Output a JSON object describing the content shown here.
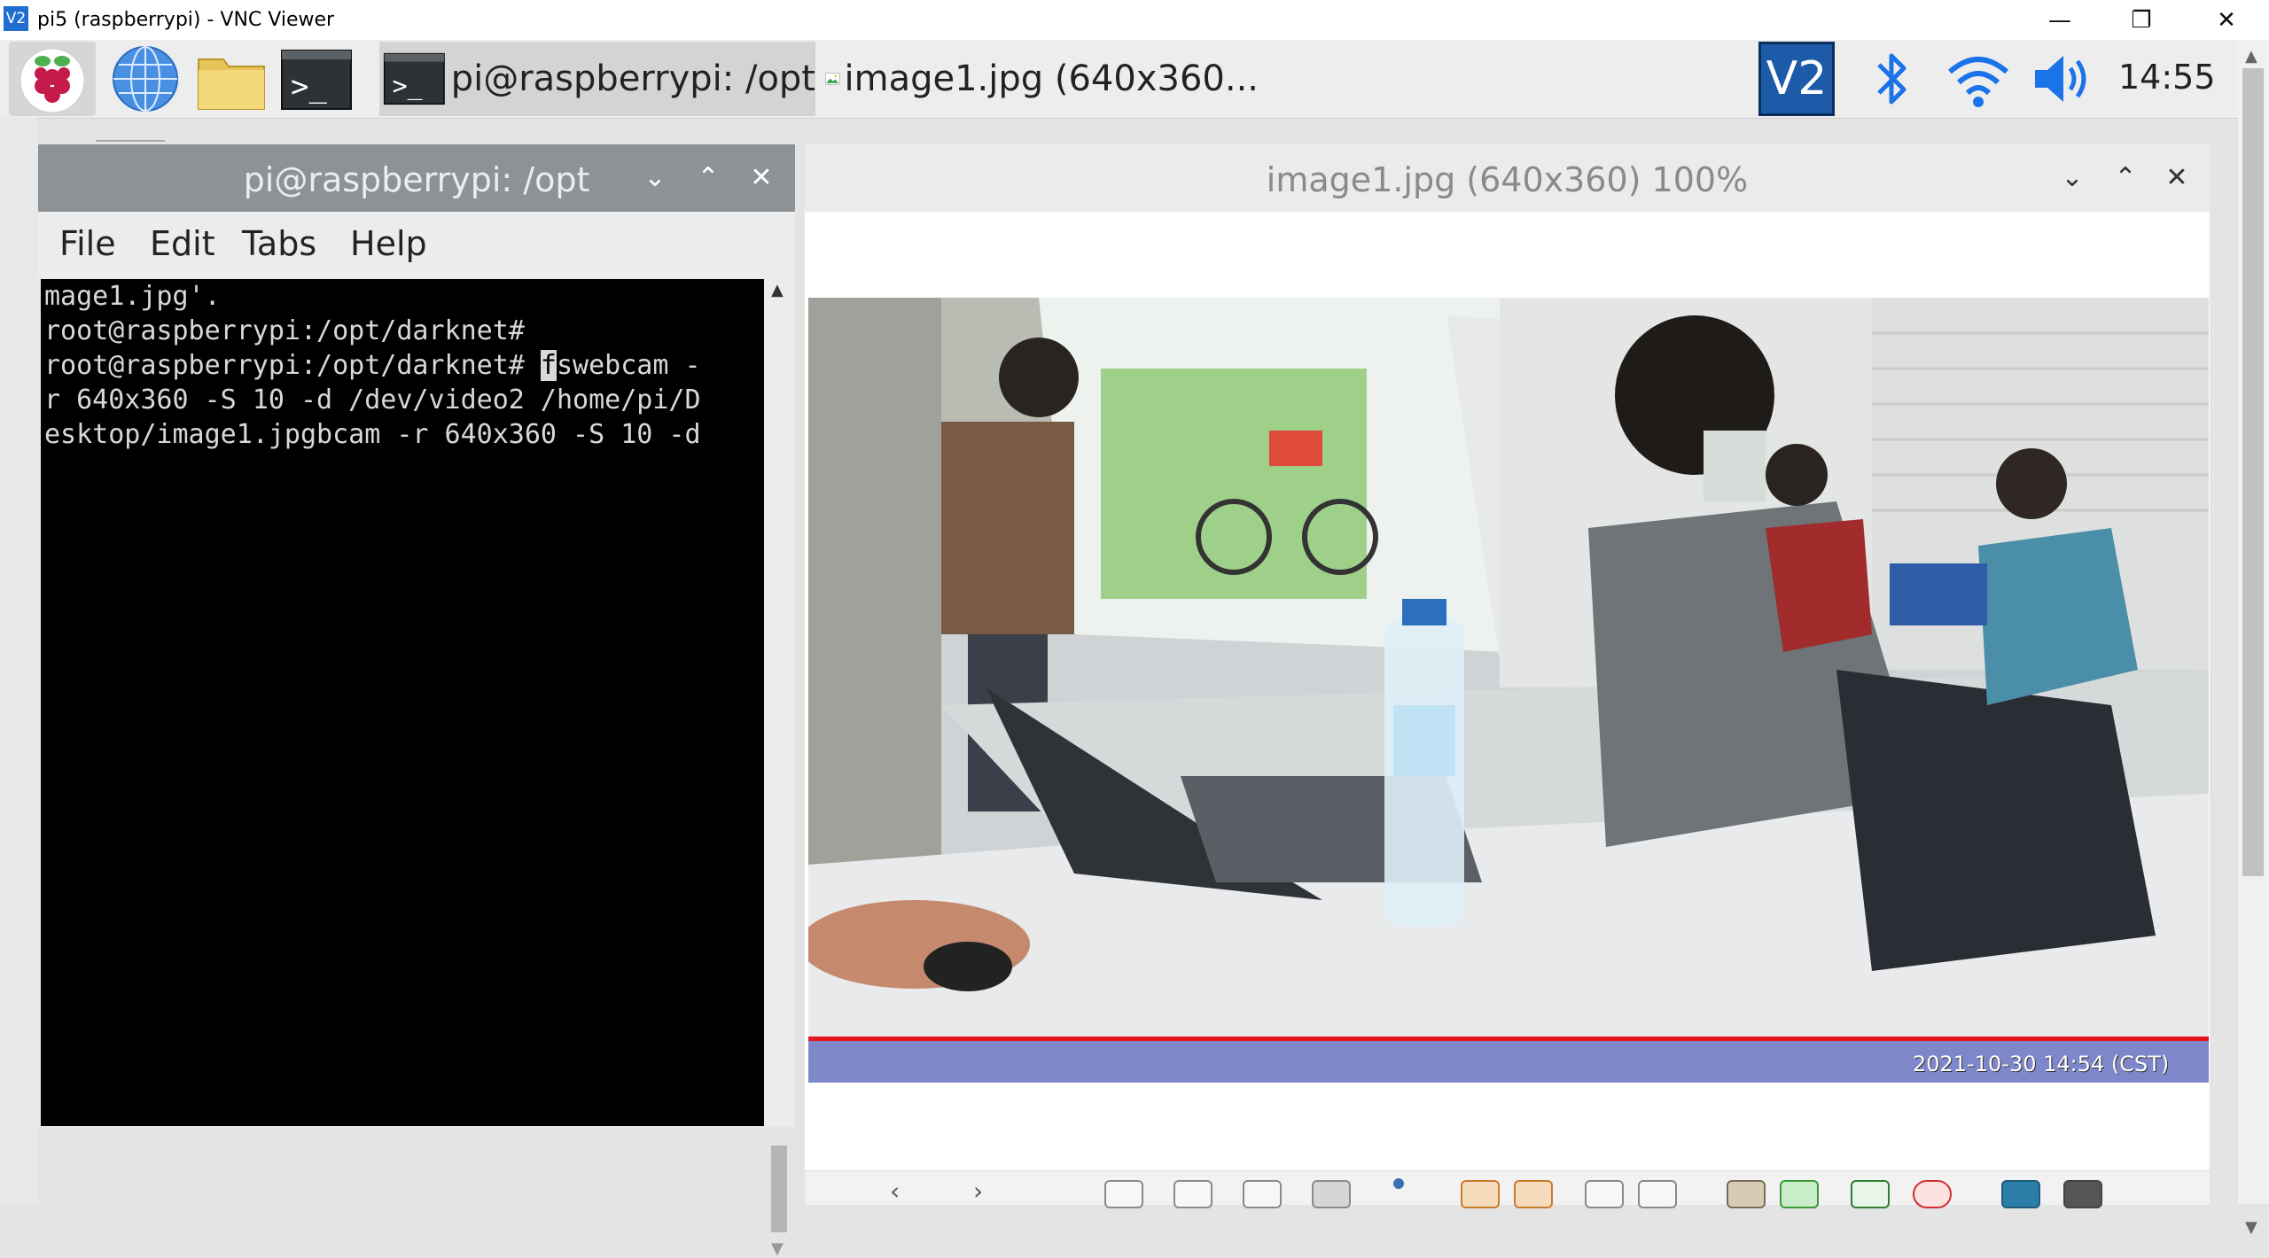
{
  "vnc_window": {
    "logo_text": "V2",
    "title": "pi5 (raspberrypi) - VNC Viewer",
    "minimize_glyph": "—",
    "maximize_glyph": "❐",
    "close_glyph": "✕"
  },
  "taskbar": {
    "tasks": [
      {
        "label": "pi@raspberrypi: /opt",
        "icon": "terminal-icon"
      },
      {
        "label": "image1.jpg (640x360...",
        "icon": "image-viewer-icon"
      }
    ],
    "tray": {
      "vnc_logo_text": "V2",
      "clock": "14:55"
    },
    "launchers": [
      "raspberry-menu-icon",
      "web-browser-icon",
      "file-manager-icon",
      "terminal-icon"
    ]
  },
  "terminal": {
    "title": "pi@raspberrypi: /opt",
    "menu": [
      "File",
      "Edit",
      "Tabs",
      "Help"
    ],
    "lines": [
      "mage1.jpg'.",
      "root@raspberrypi:/opt/darknet#",
      "root@raspberrypi:/opt/darknet# ",
      "r 640x360 -S 10 -d /dev/video2 /home/pi/D",
      "esktop/image1.jpgbcam -r 640x360 -S 10 -d"
    ],
    "line3_cursor_char": "f",
    "line3_rest": "swebcam -"
  },
  "image_viewer": {
    "title": "image1.jpg (640x360) 100%",
    "timestamp": "2021-10-30 14:54 (CST)"
  },
  "colors": {
    "taskbar_bg": "#ededed",
    "term_titlebar": "#8c9296",
    "accent_blue": "#1a73e8",
    "photo_banner": "#7d87c9",
    "photo_red_line": "#e3161c"
  }
}
